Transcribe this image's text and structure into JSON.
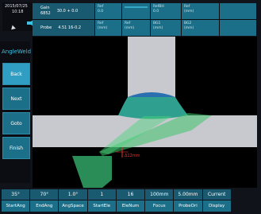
{
  "status": {
    "date": "2015/07/25",
    "time": "10:18"
  },
  "params": {
    "gain_label": "Gain",
    "gain_sub": "6852",
    "gain_value": "30.0 + 0.0",
    "probe_label": "Probe",
    "probe_value": "4.51 16-0.2",
    "top_cells": [
      {
        "label": "Ref",
        "value": "0.0"
      },
      {
        "label": "RefBH",
        "value": "0.0"
      },
      {
        "label": "Ref",
        "value": "(mm)"
      }
    ],
    "bottom_cells": [
      {
        "label": "Ref",
        "value": "(mm)"
      },
      {
        "label": "Ref",
        "value": "(mm)"
      },
      {
        "label": "BG1",
        "value": "(mm)"
      },
      {
        "label": "BG2",
        "value": "(mm)"
      }
    ]
  },
  "side_panel": {
    "title": "AngleWeld",
    "buttons": [
      {
        "label": "Back",
        "active": true
      },
      {
        "label": "Next",
        "active": false
      },
      {
        "label": "Goto",
        "active": false
      },
      {
        "label": "Finish",
        "active": false
      }
    ]
  },
  "viewport": {
    "marker_label": "Δ12mm"
  },
  "softkeys": [
    {
      "value": "35°",
      "label": "StartAng"
    },
    {
      "value": "70°",
      "label": "EndAng"
    },
    {
      "value": "1.0°",
      "label": "AngSpace"
    },
    {
      "value": "1",
      "label": "StartEle"
    },
    {
      "value": "16",
      "label": "EleNum"
    },
    {
      "value": "100mm",
      "label": "Focus"
    },
    {
      "value": "5.00mm",
      "label": "ProbeOri"
    },
    {
      "value": "Current",
      "label": "Display"
    }
  ],
  "colors": {
    "accent": "#1c6f88",
    "accent_active": "#2f9ec2",
    "weld": "#2fa08f",
    "beam": "#3ec26a",
    "plate": "#c7c9ce",
    "marker": "#e33333"
  }
}
